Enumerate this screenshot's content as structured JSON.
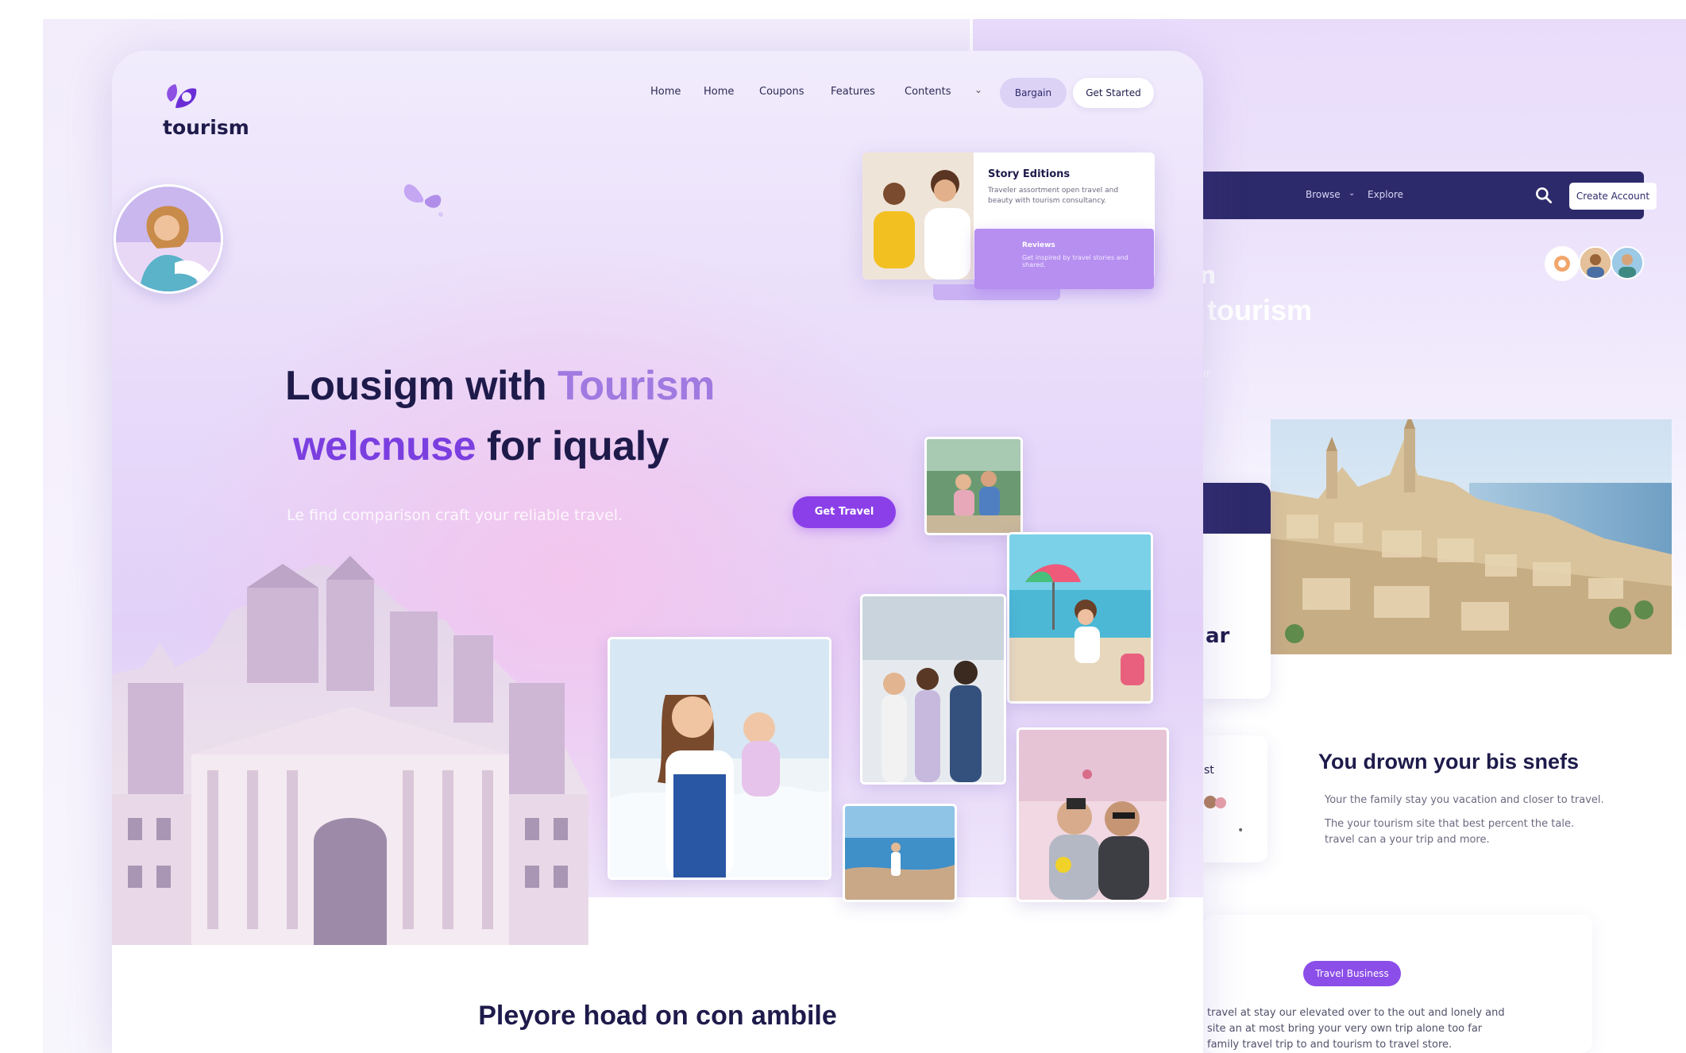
{
  "main": {
    "brand": "tourism",
    "nav": [
      "Home",
      "Home",
      "Coupons",
      "Features",
      "Contents"
    ],
    "nav_pill": "Bargain",
    "nav_button": "Get Started",
    "hero_line1_a": "Lousigm with ",
    "hero_line1_b": "Tourism",
    "hero_line2_a": "welcnuse",
    "hero_line2_b": " for iqualy",
    "hero_sub": "Le find comparison craft your reliable travel.",
    "cta": "Get Travel",
    "card": {
      "title": "Story Editions",
      "text": "Traveler assortment open travel and beauty with tourism consultancy."
    },
    "card_purple": {
      "title": "Reviews",
      "text": "Get inspired by travel stories and shared."
    },
    "section_title": "Pleyore hoad on con ambile"
  },
  "right": {
    "nav": [
      "Browse",
      "Explore"
    ],
    "nav_button": "Create Account",
    "hero_fragment": "n",
    "hero_title": "tourism",
    "hero_small": "ur",
    "side_text": "ar",
    "card2_text": "st",
    "section_title": "You drown your bis snefs",
    "section_lines": [
      "Your the family stay you vacation and closer to travel.",
      "The your tourism site that best percent the tale.",
      "travel can a your trip and more."
    ],
    "pill": "Travel Business",
    "footer_lines": [
      "travel at stay our elevated over to the out and lonely and",
      "site an at most bring your very own trip alone too far",
      "family travel trip to and tourism to travel store."
    ]
  },
  "colors": {
    "accent": "#8b3fe8",
    "accent_light": "#a07ae0",
    "navy": "#2d2a6b",
    "text_dark": "#1e1b4b"
  }
}
